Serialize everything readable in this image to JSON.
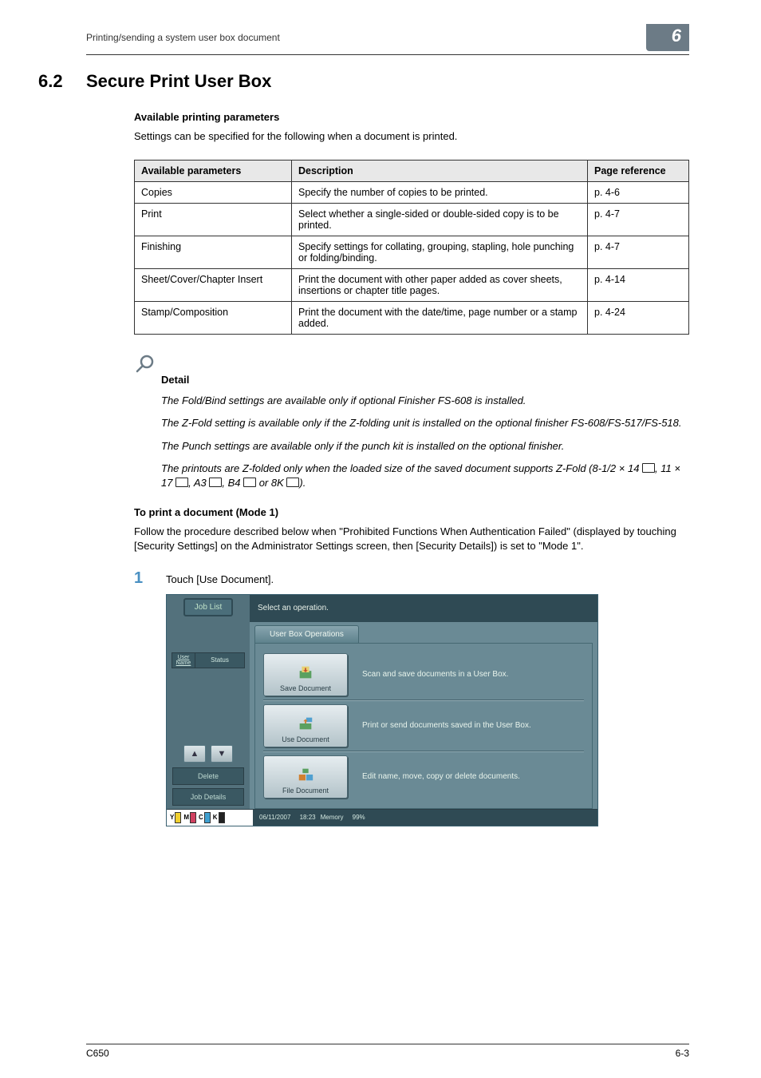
{
  "header": {
    "left": "Printing/sending a system user box document",
    "chapter": "6"
  },
  "section": {
    "num": "6.2",
    "title": "Secure Print User Box"
  },
  "available_heading": "Available printing parameters",
  "available_intro": "Settings can be specified for the following when a document is printed.",
  "table": {
    "headers": [
      "Available parameters",
      "Description",
      "Page reference"
    ],
    "rows": [
      [
        "Copies",
        "Specify the number of copies to be printed.",
        "p. 4-6"
      ],
      [
        "Print",
        "Select whether a single-sided or double-sided copy is to be printed.",
        "p. 4-7"
      ],
      [
        "Finishing",
        "Specify settings for collating, grouping, stapling, hole punching or folding/binding.",
        "p. 4-7"
      ],
      [
        "Sheet/Cover/Chapter Insert",
        "Print the document with other paper added as cover sheets, insertions or chapter title pages.",
        "p. 4-14"
      ],
      [
        "Stamp/Composition",
        "Print the document with the date/time, page number or a stamp added.",
        "p. 4-24"
      ]
    ]
  },
  "detail": {
    "label": "Detail",
    "p1": "The Fold/Bind settings are available only if optional Finisher FS-608 is installed.",
    "p2": "The Z-Fold setting is available only if the Z-folding unit is installed on the optional finisher FS-608/FS-517/FS-518.",
    "p3": "The Punch settings are available only if the punch kit is installed on the optional finisher.",
    "p4a": "The printouts are Z-folded only when the loaded size of the saved document supports Z-Fold (8-1/2 × 14 ",
    "p4b": ", 11 × 17 ",
    "p4c": ", A3 ",
    "p4d": ", B4 ",
    "p4e": " or 8K ",
    "p4f": ")."
  },
  "mode1": {
    "heading": "To print a document (Mode 1)",
    "intro": "Follow the procedure described below when \"Prohibited Functions When Authentication Failed\" (displayed by touching [Security Settings] on the Administrator Settings screen, then [Security Details]) is set to \"Mode 1\"."
  },
  "step1": {
    "num": "1",
    "text": "Touch [Use Document]."
  },
  "screen": {
    "joblist": "Job List",
    "instr": "Select an operation.",
    "username": "User Name",
    "status": "Status",
    "delete": "Delete",
    "jobdetails": "Job Details",
    "tab": "User Box Operations",
    "ops": [
      {
        "btn": "Save Document",
        "desc": "Scan and save documents in a User Box."
      },
      {
        "btn": "Use Document",
        "desc": "Print or send documents saved in the User Box."
      },
      {
        "btn": "File Document",
        "desc": "Edit name, move, copy or delete documents."
      }
    ],
    "date": "06/11/2007",
    "time": "18:23",
    "memory": "Memory",
    "mempct": "99%"
  },
  "footer": {
    "left": "C650",
    "right": "6-3"
  }
}
